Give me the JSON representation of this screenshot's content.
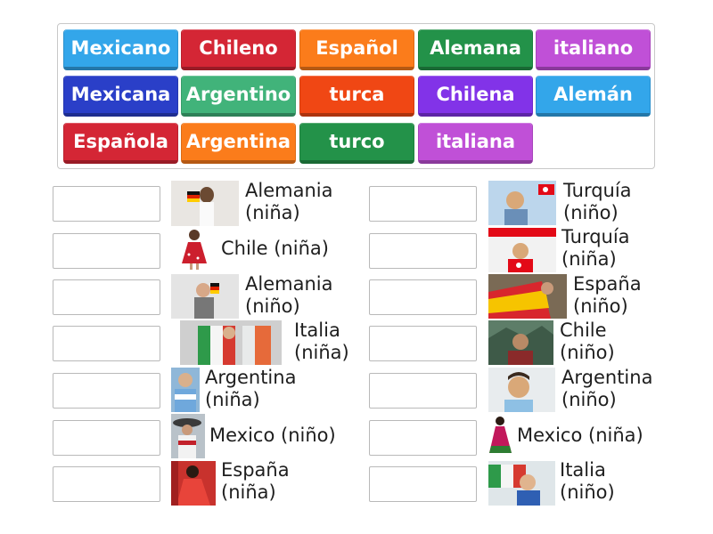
{
  "tiles": [
    {
      "label": "Mexicano",
      "color": "#33a6ea"
    },
    {
      "label": "Chileno",
      "color": "#d42635"
    },
    {
      "label": "Español",
      "color": "#fb7c1b"
    },
    {
      "label": "Alemana",
      "color": "#239249"
    },
    {
      "label": "italiano",
      "color": "#c050d7"
    },
    {
      "label": "Mexicana",
      "color": "#2a3fc8"
    },
    {
      "label": "Argentino",
      "color": "#41b37a"
    },
    {
      "label": "turca",
      "color": "#f04714"
    },
    {
      "label": "Chilena",
      "color": "#8233e8"
    },
    {
      "label": "Alemán",
      "color": "#33a6ea"
    },
    {
      "label": "Española",
      "color": "#d42635"
    },
    {
      "label": "Argentina",
      "color": "#fb7c1b"
    },
    {
      "label": "turco",
      "color": "#239249"
    },
    {
      "label": "italiana",
      "color": "#c050d7"
    }
  ],
  "left_items": [
    {
      "line1": "Alemania",
      "line2": "(niña)",
      "image": "germany-girl-photo"
    },
    {
      "line1": "Chile (niña)",
      "line2": "",
      "image": "chile-girl-photo"
    },
    {
      "line1": "Alemania",
      "line2": "(niño)",
      "image": "germany-boy-photo"
    },
    {
      "line1": "Italia",
      "line2": "(niña)",
      "image": "italy-girl-photo"
    },
    {
      "line1": "Argentina",
      "line2": "(niña)",
      "image": "argentina-girl-photo"
    },
    {
      "line1": "Mexico (niño)",
      "line2": "",
      "image": "mexico-boy-photo"
    },
    {
      "line1": "España",
      "line2": "(niña)",
      "image": "spain-girl-photo"
    }
  ],
  "right_items": [
    {
      "line1": "Turquía",
      "line2": "(niño)",
      "image": "turkey-boy-photo"
    },
    {
      "line1": "Turquía",
      "line2": "(niña)",
      "image": "turkey-girl-photo"
    },
    {
      "line1": "España",
      "line2": "(niño)",
      "image": "spain-boy-photo"
    },
    {
      "line1": "Chile",
      "line2": "(niño)",
      "image": "chile-boy-photo"
    },
    {
      "line1": "Argentina",
      "line2": "(niño)",
      "image": "argentina-boy-photo"
    },
    {
      "line1": "Mexico (niña)",
      "line2": "",
      "image": "mexico-girl-photo"
    },
    {
      "line1": "Italia",
      "line2": "(niño)",
      "image": "italy-boy-photo"
    }
  ]
}
